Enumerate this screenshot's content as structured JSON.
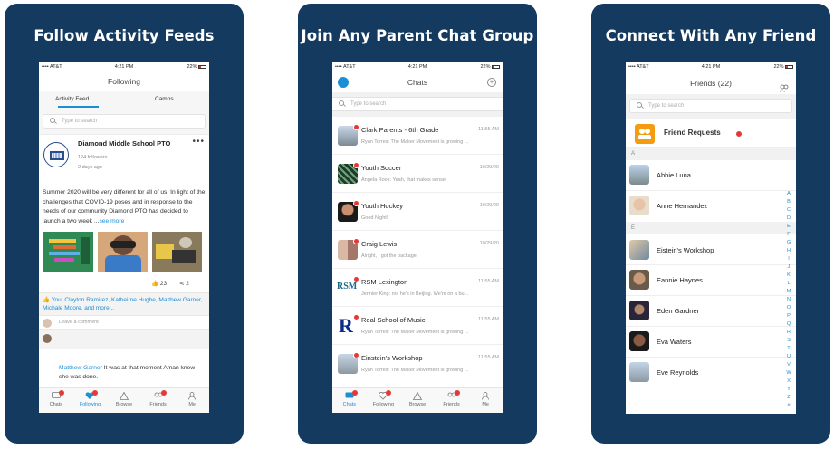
{
  "panels": [
    {
      "title": "Follow Activity Feeds"
    },
    {
      "title": "Join Any Parent Chat Group"
    },
    {
      "title": "Connect With Any Friend"
    }
  ],
  "status": {
    "carrier": "AT&T",
    "time": "4:21 PM",
    "battery": "22%"
  },
  "tabs": {
    "chats": "Chats",
    "following": "Following",
    "browse": "Browse",
    "friends": "Friends",
    "me": "Me"
  },
  "feed": {
    "nav_title": "Following",
    "segment_activity": "Activity Feed",
    "segment_camps": "Camps",
    "search_placeholder": "Type to search",
    "post": {
      "org": "Diamond Middle School PTO",
      "followers": "124 followers",
      "time": "2 days ago",
      "body": "Summer 2020 will be very different for all of us. In light of the challenges that COVID-19 poses and in response to the needs of our community Diamond PTO has decided to launch a two week ...",
      "see_more": "see more",
      "likes": "23",
      "shares": "2",
      "likers": "You,  Clayton Ramirez,  Katheirne Hughe, Matthew Garner,  Michale Moore, and more...",
      "comment_placeholder": "Leave a comment",
      "comment_author": "Matthew Garner",
      "comment_text": " It was at that moment Aman knew she was done."
    }
  },
  "chats": {
    "nav_title": "Chats",
    "search_placeholder": "Type to search",
    "items": [
      {
        "name": "Clark Parents - 6th Grade",
        "time": "11:55 AM",
        "preview": "Ryan Torres: The Maker Movement is growing ..."
      },
      {
        "name": "Youth Soccer",
        "time": "10/29/20",
        "preview": "Angela Roos: Yeah, that makes sense!"
      },
      {
        "name": "Youth Hockey",
        "time": "10/29/20",
        "preview": "Good Night!"
      },
      {
        "name": "Craig Lewis",
        "time": "10/29/20",
        "preview": "Alright, I got the package."
      },
      {
        "name": "RSM Lexington",
        "time": "11:55 AM",
        "preview": "Jennier King: no, he's in Beijing. We're on a bu..."
      },
      {
        "name": "Real School of Music",
        "time": "11:55 AM",
        "preview": "Ryan Torres: The Maker Movement is growing ..."
      },
      {
        "name": "Einstein's Workshop",
        "time": "11:55 AM",
        "preview": "Ryan Torres: The Maker Movement is growing ..."
      }
    ]
  },
  "friends": {
    "nav_title": "Friends (22)",
    "search_placeholder": "Type to search",
    "requests_label": "Friend Requests",
    "section_a": "A",
    "section_e": "E",
    "list": [
      "Abbie Luna",
      "Anne Hernandez",
      "Eistein's Workshop",
      "Eannie Haynes",
      "Eden Gardner",
      "Eva Waters",
      "Eve Reynolds"
    ],
    "index": [
      "A",
      "B",
      "C",
      "D",
      "E",
      "F",
      "G",
      "H",
      "I",
      "J",
      "K",
      "L",
      "M",
      "N",
      "O",
      "P",
      "Q",
      "R",
      "S",
      "T",
      "U",
      "V",
      "W",
      "X",
      "Y",
      "Z",
      "#"
    ]
  },
  "colors": {
    "card_bg": "#153a5f",
    "accent": "#1a8fd6",
    "badge": "#e53935",
    "request_icon": "#f39c12"
  }
}
